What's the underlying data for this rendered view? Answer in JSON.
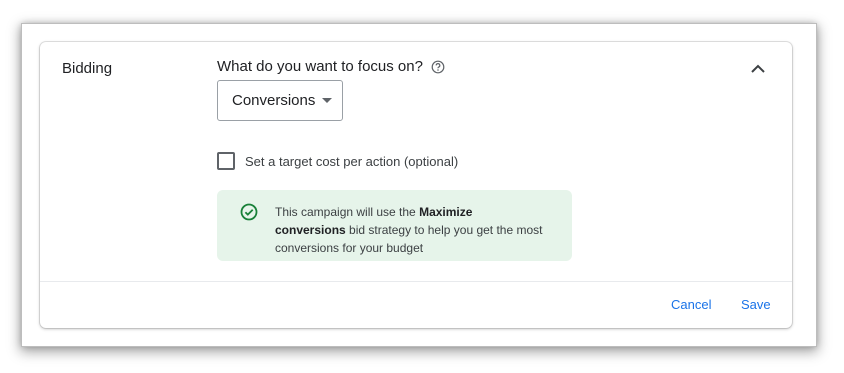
{
  "section": {
    "title": "Bidding"
  },
  "focus": {
    "question": "What do you want to focus on?",
    "help_icon": "help-circle-icon",
    "selected": "Conversions"
  },
  "collapse_icon": "chevron-up-icon",
  "target_cpa": {
    "label": "Set a target cost per action (optional)",
    "checked": false
  },
  "info": {
    "icon": "check-circle-icon",
    "text_before": "This campaign will use the ",
    "strategy": "Maximize conversions",
    "text_after": " bid strategy to help you get the most conversions for your budget"
  },
  "actions": {
    "cancel": "Cancel",
    "save": "Save"
  },
  "colors": {
    "accent": "#1a73e8",
    "success": "#188038",
    "info_bg": "#e6f4ea"
  }
}
